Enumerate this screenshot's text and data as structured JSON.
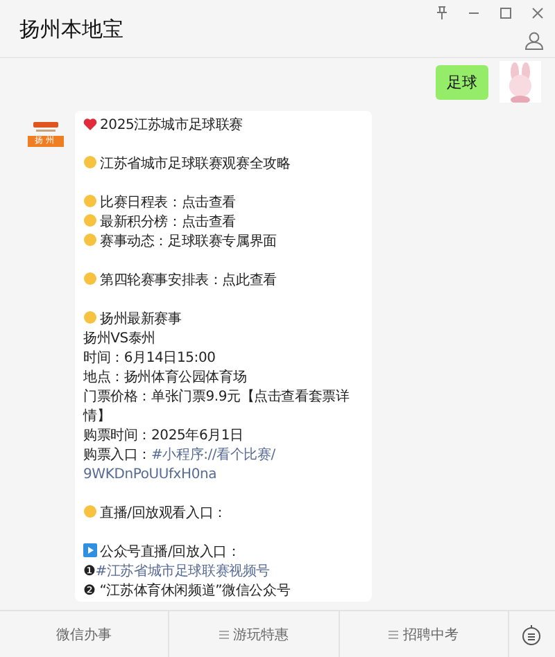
{
  "window": {
    "title": "扬州本地宝"
  },
  "outgoing": {
    "text": "足球"
  },
  "sender": {
    "badge": "扬州"
  },
  "article": [
    [
      {
        "kind": "heart",
        "parts": [
          {
            "text": "2025江苏城市足球联赛",
            "link": false
          }
        ]
      }
    ],
    [
      {
        "kind": "dot",
        "parts": [
          {
            "text": "江苏省城市足球联赛观赛全攻略",
            "link": false
          }
        ]
      }
    ],
    [
      {
        "kind": "dot",
        "parts": [
          {
            "text": "比赛日程表：点击查看",
            "link": false
          }
        ]
      },
      {
        "kind": "dot",
        "parts": [
          {
            "text": "最新积分榜：点击查看",
            "link": false
          }
        ]
      },
      {
        "kind": "dot",
        "parts": [
          {
            "text": "赛事动态：足球联赛专属界面",
            "link": false
          }
        ]
      }
    ],
    [
      {
        "kind": "dot",
        "parts": [
          {
            "text": "第四轮赛事安排表：点此查看",
            "link": false
          }
        ]
      }
    ],
    [
      {
        "kind": "dot",
        "parts": [
          {
            "text": "扬州最新赛事",
            "link": false
          }
        ]
      },
      {
        "kind": "plain",
        "parts": [
          {
            "text": "扬州VS泰州",
            "link": false
          }
        ]
      },
      {
        "kind": "plain",
        "parts": [
          {
            "text": "时间：6月14日15:00",
            "link": false
          }
        ]
      },
      {
        "kind": "plain",
        "parts": [
          {
            "text": "地点：扬州体育公园体育场",
            "link": false
          }
        ]
      },
      {
        "kind": "plain",
        "parts": [
          {
            "text": "门票价格：单张门票9.9元【点击查看套票详情】",
            "link": false
          }
        ]
      },
      {
        "kind": "plain",
        "parts": [
          {
            "text": "购票时间：2025年6月1日",
            "link": false
          }
        ]
      },
      {
        "kind": "plain",
        "parts": [
          {
            "text": "购票入口：",
            "link": false
          },
          {
            "text": "#小程序://看个比赛/",
            "link": true
          }
        ]
      },
      {
        "kind": "plain",
        "parts": [
          {
            "text": "9WKDnPoUUfxH0na",
            "link": true
          }
        ]
      }
    ],
    [
      {
        "kind": "dot",
        "parts": [
          {
            "text": "直播/回放观看入口：",
            "link": false
          }
        ]
      }
    ],
    [
      {
        "kind": "play",
        "parts": [
          {
            "text": "公众号直播/回放入口：",
            "link": false
          }
        ]
      },
      {
        "kind": "plain",
        "parts": [
          {
            "text": "❶",
            "link": false
          },
          {
            "text": "#江苏省城市足球联赛视频号",
            "link": true
          }
        ]
      },
      {
        "kind": "plain",
        "parts": [
          {
            "text": "❷ “江苏体育休闲频道”微信公众号",
            "link": false
          }
        ]
      }
    ]
  ],
  "menu": [
    {
      "label": "微信办事",
      "has_submenu": false
    },
    {
      "label": "游玩特惠",
      "has_submenu": true
    },
    {
      "label": "招聘中考",
      "has_submenu": true
    }
  ]
}
